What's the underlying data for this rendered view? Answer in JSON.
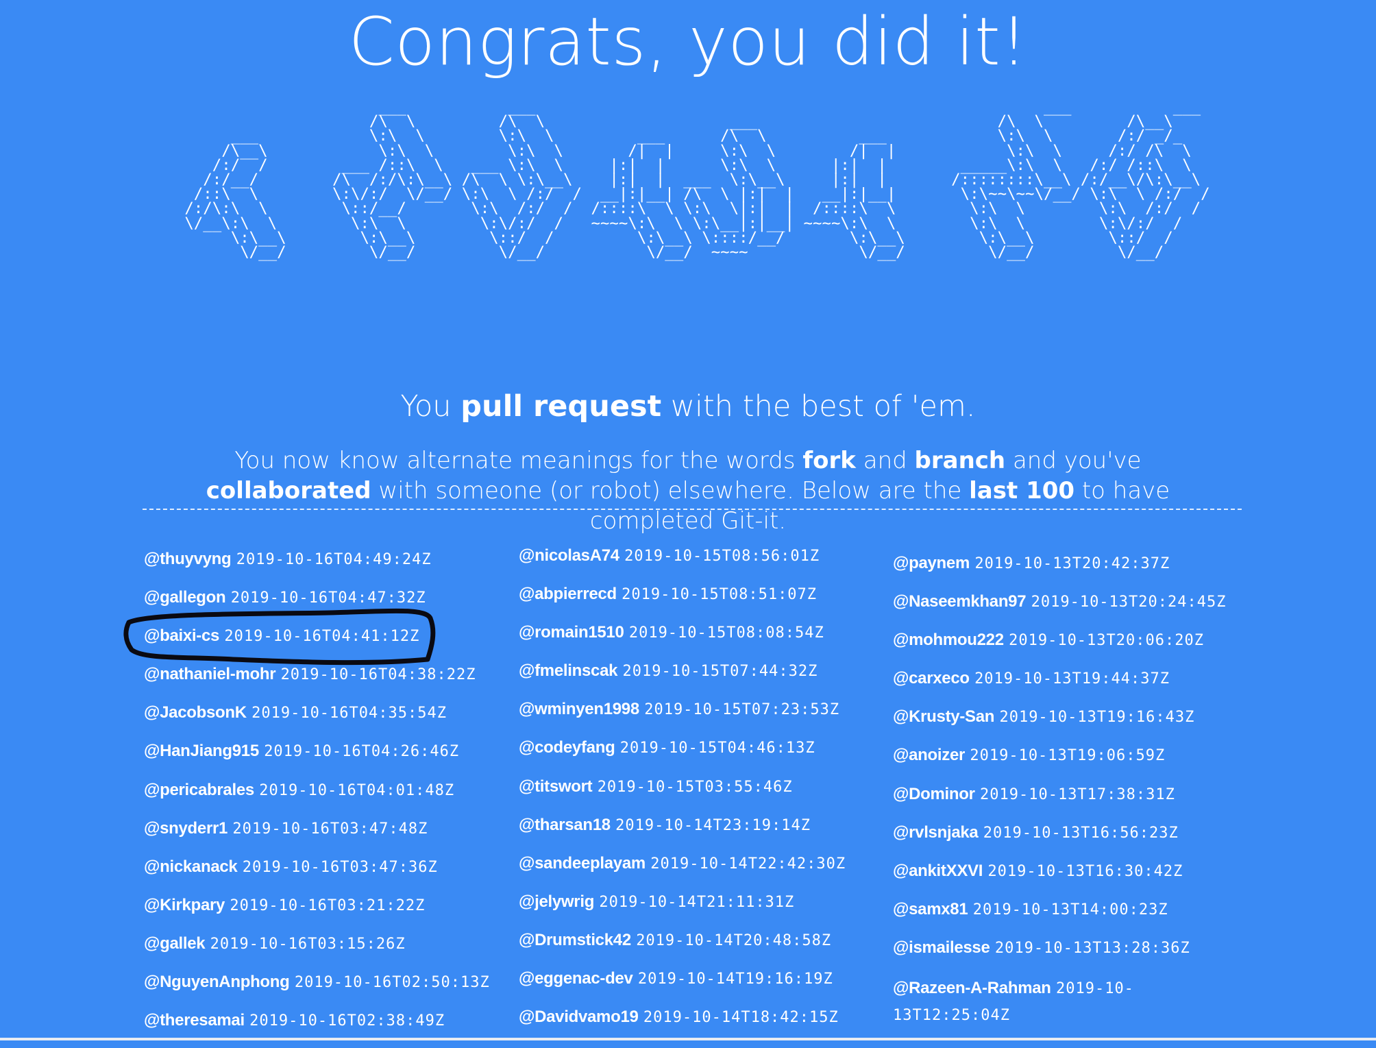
{
  "hero": {
    "title": "Congrats, you did it!"
  },
  "ascii_art": "                           ___           ___                                                       ___           ___     \n                          /\\  \\         /\\  \\                    ___                          /\\  \\         /\\__\\    \n           ___            \\:\\  \\        \\:\\  \\         ___      /\\  \\          ___            \\:\\  \\       /:/ _/_   \n          /\\__\\            \\:\\  \\        \\:\\  \\       /|  |     \\:\\  \\        /|  |            \\:\\  \\     /:/ /\\  \\  \n         /:/  /        ___ /::\\  \\   ___ \\:\\  \\     |:|  |      \\:\\  \\      |:|  |        _____\\:\\  \\   /:/ /::\\  \\ \n        /:/__/        /\\  /:/\\:\\__\\ /\\  \\ \\:\\__\\    |:|  |  ___  \\:\\__\\     |:|  |       /::::::::\\__\\ /:/__\\/\\:\\__\\\n       /::\\  \\        \\:\\/:/  \\/__/ \\:\\  \\ /:/  /  __|:|__| /\\  \\ |:|  |   __|:|__|       \\:\\~~\\~~\\/__/ \\:\\  \\ /:/  /\n      /:/\\:\\  \\        \\::/__/       \\:\\  /:/  /  /::::\\  \\ \\:\\  \\|:|  |  /::::\\  \\        \\:\\  \\        \\:\\  /:/  / \n      \\/__\\:\\  \\        \\:\\  \\        \\:\\/:/  /   ~~~~\\:\\  \\ \\:\\__|:|__| ~~~~\\:\\  \\        \\:\\  \\        \\:\\/:/  /  \n           \\:\\__\\        \\:\\__\\        \\::/  /         \\:\\__\\ \\::::/__/       \\:\\__\\        \\:\\__\\        \\::/  /   \n            \\/__/         \\/__/         \\/__/           \\/__/  ~~~~            \\/__/         \\/__/         \\/__/    ",
  "tagline": {
    "pre": "You ",
    "strong": "pull request",
    "post": " with the best of 'em."
  },
  "summary": {
    "t1": "You now know alternate meanings for the words ",
    "b1": "fork",
    "t2": " and ",
    "b2": "branch",
    "t3": " and you've ",
    "b3": "collaborated",
    "t4": " with someone (or robot) elsewhere. Below are the ",
    "b4": "last 100",
    "t5": " to have completed Git-it."
  },
  "completions": {
    "col1": [
      {
        "user": "@thuyvyng",
        "time": "2019-10-16T04:49:24Z"
      },
      {
        "user": "@gallegon",
        "time": "2019-10-16T04:47:32Z"
      },
      {
        "user": "@baixi-cs",
        "time": "2019-10-16T04:41:12Z"
      },
      {
        "user": "@nathaniel-mohr",
        "time": "2019-10-16T04:38:22Z"
      },
      {
        "user": "@JacobsonK",
        "time": "2019-10-16T04:35:54Z"
      },
      {
        "user": "@HanJiang915",
        "time": "2019-10-16T04:26:46Z"
      },
      {
        "user": "@pericabrales",
        "time": "2019-10-16T04:01:48Z"
      },
      {
        "user": "@snyderr1",
        "time": "2019-10-16T03:47:48Z"
      },
      {
        "user": "@nickanack",
        "time": "2019-10-16T03:47:36Z"
      },
      {
        "user": "@Kirkpary",
        "time": "2019-10-16T03:21:22Z"
      },
      {
        "user": "@gallek",
        "time": "2019-10-16T03:15:26Z"
      },
      {
        "user": "@NguyenAnphong",
        "time": "2019-10-16T02:50:13Z"
      },
      {
        "user": "@theresamai",
        "time": "2019-10-16T02:38:49Z"
      }
    ],
    "col2": [
      {
        "user": "@nicolasA74",
        "time": "2019-10-15T08:56:01Z"
      },
      {
        "user": "@abpierrecd",
        "time": "2019-10-15T08:51:07Z"
      },
      {
        "user": "@romain1510",
        "time": "2019-10-15T08:08:54Z"
      },
      {
        "user": "@fmelinscak",
        "time": "2019-10-15T07:44:32Z"
      },
      {
        "user": "@wminyen1998",
        "time": "2019-10-15T07:23:53Z"
      },
      {
        "user": "@codeyfang",
        "time": "2019-10-15T04:46:13Z"
      },
      {
        "user": "@titswort",
        "time": "2019-10-15T03:55:46Z"
      },
      {
        "user": "@tharsan18",
        "time": "2019-10-14T23:19:14Z"
      },
      {
        "user": "@sandeeplayam",
        "time": "2019-10-14T22:42:30Z"
      },
      {
        "user": "@jelywrig",
        "time": "2019-10-14T21:11:31Z"
      },
      {
        "user": "@Drumstick42",
        "time": "2019-10-14T20:48:58Z"
      },
      {
        "user": "@eggenac-dev",
        "time": "2019-10-14T19:16:19Z"
      },
      {
        "user": "@Davidvamo19",
        "time": "2019-10-14T18:42:15Z"
      }
    ],
    "col3": [
      {
        "user": "@paynem",
        "time": "2019-10-13T20:42:37Z"
      },
      {
        "user": "@Naseemkhan97",
        "time": "2019-10-13T20:24:45Z"
      },
      {
        "user": "@mohmou222",
        "time": "2019-10-13T20:06:20Z"
      },
      {
        "user": "@carxeco",
        "time": "2019-10-13T19:44:37Z"
      },
      {
        "user": "@Krusty-San",
        "time": "2019-10-13T19:16:43Z"
      },
      {
        "user": "@anoizer",
        "time": "2019-10-13T19:06:59Z"
      },
      {
        "user": "@Dominor",
        "time": "2019-10-13T17:38:31Z"
      },
      {
        "user": "@rvlsnjaka",
        "time": "2019-10-13T16:56:23Z"
      },
      {
        "user": "@ankitXXVI",
        "time": "2019-10-13T16:30:42Z"
      },
      {
        "user": "@samx81",
        "time": "2019-10-13T14:00:23Z"
      },
      {
        "user": "@ismailesse",
        "time": "2019-10-13T13:28:36Z"
      },
      {
        "user": "@Razeen-A-Rahman",
        "time": "2019-10-13T12:25:04Z"
      }
    ]
  },
  "annotation": {
    "color": "#0a0a12",
    "highlighted_user": "@baixi-cs"
  },
  "colors": {
    "background": "#3a8af4",
    "text": "#ffffff"
  }
}
